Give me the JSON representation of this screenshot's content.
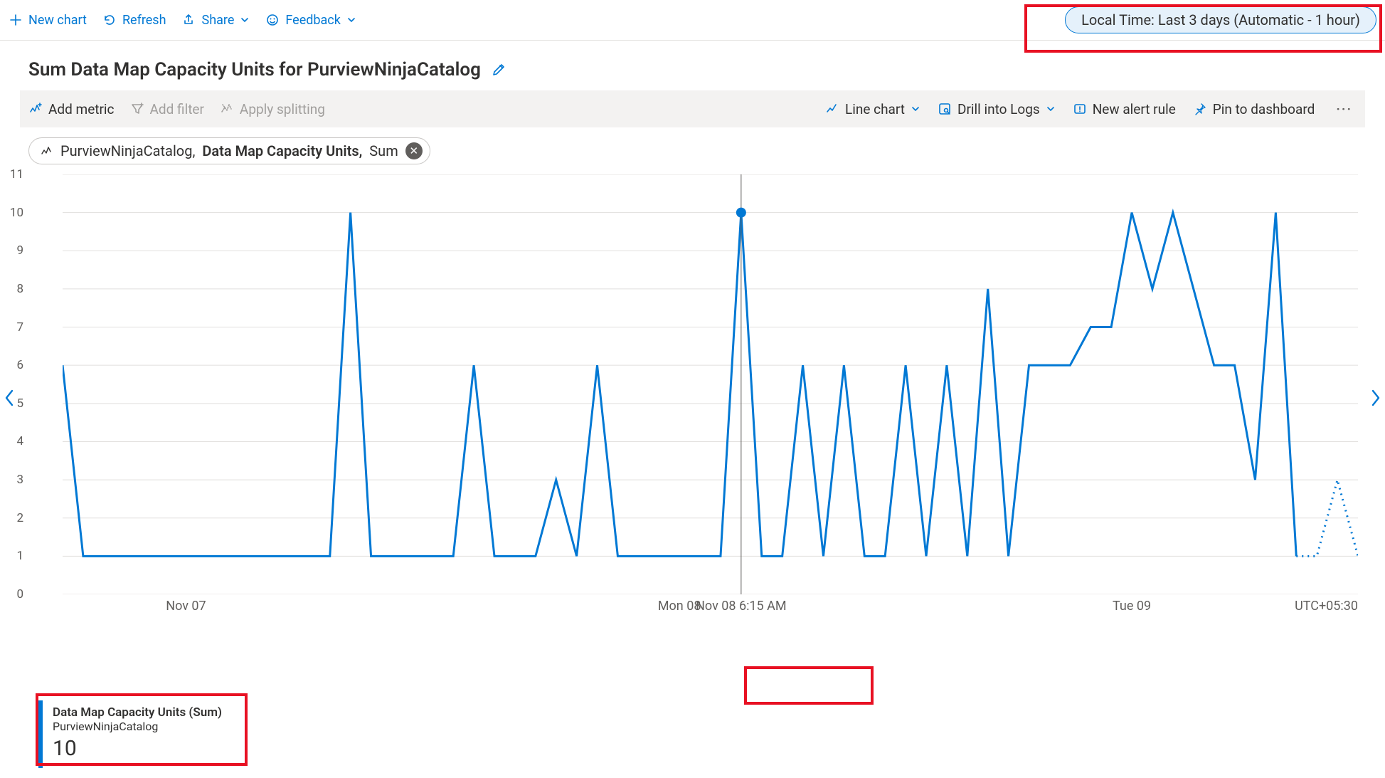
{
  "toolbar": {
    "new_chart": "New chart",
    "refresh": "Refresh",
    "share": "Share",
    "feedback": "Feedback"
  },
  "time_range": "Local Time: Last 3 days (Automatic - 1 hour)",
  "chart_title": "Sum Data Map Capacity Units for PurviewNinjaCatalog",
  "chart_toolbar": {
    "add_metric": "Add metric",
    "add_filter": "Add filter",
    "apply_splitting": "Apply splitting",
    "line_chart": "Line chart",
    "drill_logs": "Drill into Logs",
    "new_alert": "New alert rule",
    "pin": "Pin to dashboard"
  },
  "metric_pill": {
    "resource": "PurviewNinjaCatalog,",
    "metric": "Data Map Capacity Units,",
    "agg": "Sum"
  },
  "axis": {
    "y_ticks": [
      0,
      1,
      2,
      3,
      4,
      5,
      6,
      7,
      8,
      9,
      10,
      11
    ],
    "x_ticks": [
      {
        "label": "Nov 07",
        "i": 6
      },
      {
        "label": "Mon 08",
        "i": 30
      },
      {
        "label": "Tue 09",
        "i": 52
      }
    ],
    "tz": "UTC+05:30"
  },
  "hover": {
    "index": 33,
    "value": 10,
    "label": "Nov 08 6:15 AM"
  },
  "legend": {
    "line1": "Data Map Capacity Units (Sum)",
    "line2": "PurviewNinjaCatalog",
    "value": "10"
  },
  "chart_data": {
    "type": "line",
    "title": "Sum Data Map Capacity Units for PurviewNinjaCatalog",
    "xlabel": "",
    "ylabel": "",
    "ylim": [
      0,
      11
    ],
    "series_name": "Data Map Capacity Units (Sum)",
    "resource": "PurviewNinjaCatalog",
    "x_categories_major": [
      "Nov 07",
      "Mon 08",
      "Tue 09"
    ],
    "timezone": "UTC+05:30",
    "values": [
      6,
      1,
      1,
      1,
      1,
      1,
      1,
      1,
      1,
      1,
      1,
      1,
      1,
      1,
      10,
      1,
      1,
      1,
      1,
      1,
      6,
      1,
      1,
      1,
      3,
      1,
      6,
      1,
      1,
      1,
      1,
      1,
      1,
      10,
      1,
      1,
      6,
      1,
      6,
      1,
      1,
      6,
      1,
      6,
      1,
      8,
      1,
      6,
      6,
      6,
      7,
      7,
      10,
      8,
      10,
      8,
      6,
      6,
      3,
      10,
      1
    ],
    "trailing_dotted_values": [
      1,
      3,
      1
    ],
    "hover_point": {
      "index": 33,
      "value": 10,
      "time": "Nov 08 6:15 AM"
    }
  }
}
